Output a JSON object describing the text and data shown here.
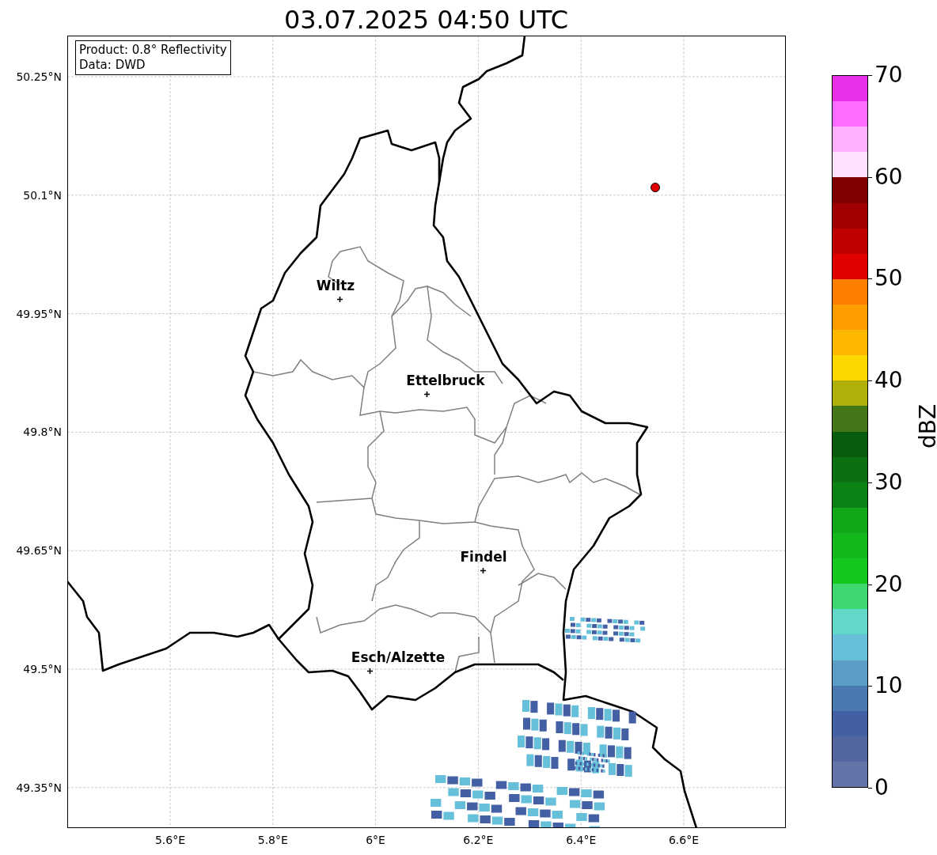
{
  "title": "03.07.2025 04:50 UTC",
  "info_box": {
    "lines": [
      "Product: 0.8° Reflectivity",
      "Data: DWD"
    ]
  },
  "lat_ticks": [
    "50.25°N",
    "50.1°N",
    "49.95°N",
    "49.8°N",
    "49.65°N",
    "49.5°N",
    "49.35°N"
  ],
  "lon_ticks": [
    "5.6°E",
    "5.8°E",
    "6°E",
    "6.2°E",
    "6.4°E",
    "6.6°E"
  ],
  "cities": [
    {
      "name": "Wiltz"
    },
    {
      "name": "Ettelbruck"
    },
    {
      "name": "Findel"
    },
    {
      "name": "Esch/Alzette"
    }
  ],
  "colorbar": {
    "label": "dBZ",
    "ticks": [
      "70",
      "60",
      "50",
      "40",
      "30",
      "20",
      "10",
      "0"
    ],
    "bands": [
      {
        "color": "#e830e8"
      },
      {
        "color": "#ff6cff"
      },
      {
        "color": "#ffb0ff"
      },
      {
        "color": "#ffe0ff"
      },
      {
        "color": "#800000"
      },
      {
        "color": "#a00000"
      },
      {
        "color": "#c00000"
      },
      {
        "color": "#e00000"
      },
      {
        "color": "#ff7e00"
      },
      {
        "color": "#ff9c00"
      },
      {
        "color": "#ffb800"
      },
      {
        "color": "#ffd700"
      },
      {
        "color": "#b0b00a"
      },
      {
        "color": "#44761a"
      },
      {
        "color": "#085c0e"
      },
      {
        "color": "#0a7012"
      },
      {
        "color": "#0c8214"
      },
      {
        "color": "#10a818"
      },
      {
        "color": "#12b81c"
      },
      {
        "color": "#14c81e"
      },
      {
        "color": "#3ed870"
      },
      {
        "color": "#62d8c8"
      },
      {
        "color": "#66c0da"
      },
      {
        "color": "#5a9ec8"
      },
      {
        "color": "#4a78b0"
      },
      {
        "color": "#4460a4"
      },
      {
        "color": "#5466a0"
      },
      {
        "color": "#6373a8"
      }
    ]
  }
}
